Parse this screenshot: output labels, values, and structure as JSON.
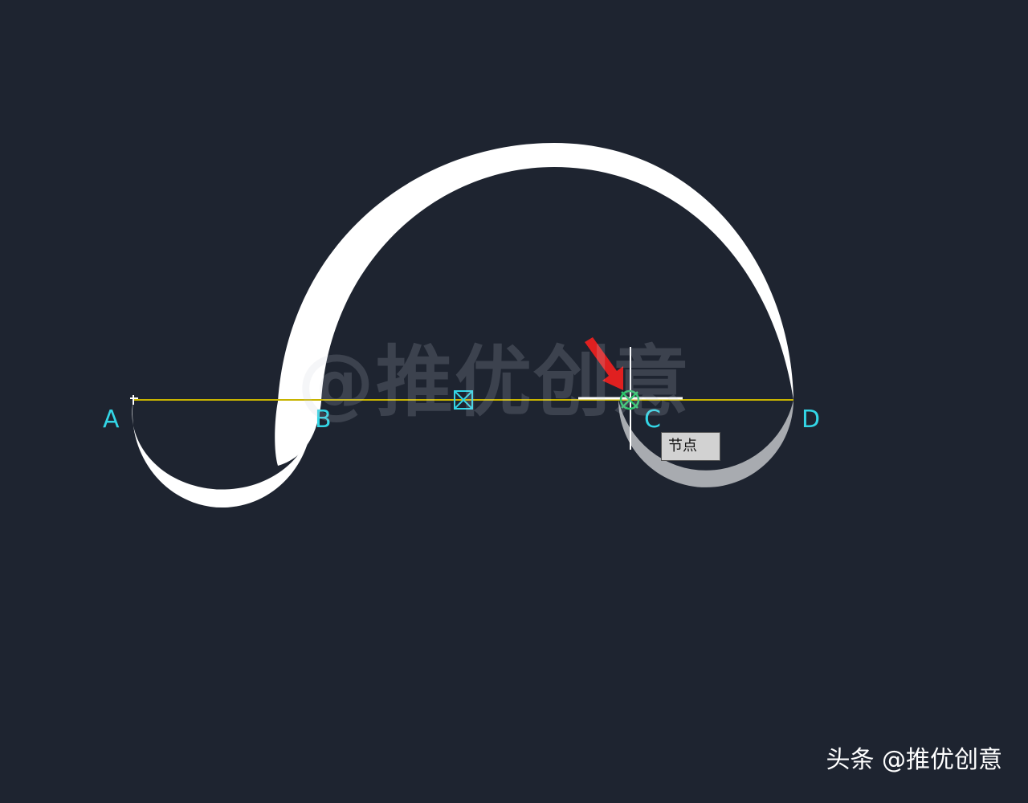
{
  "points": {
    "a": "A",
    "b": "B",
    "c": "C",
    "d": "D"
  },
  "tooltip": {
    "text": "节点"
  },
  "watermark": {
    "center": "@推优创意",
    "footer": "头条 @推优创意"
  },
  "colors": {
    "background": "#1e2430",
    "curve": "#ffffff",
    "baseline": "#c8b400",
    "point_label": "#33d6e6",
    "node_marker": "#2cc46a",
    "arrow": "#e02020",
    "preview_shape": "#a8abb0"
  },
  "icons": {
    "node_marker": "node-snap-marker-icon",
    "midpoint_marker": "midpoint-snap-marker-icon",
    "arrow": "red-arrow-icon"
  }
}
